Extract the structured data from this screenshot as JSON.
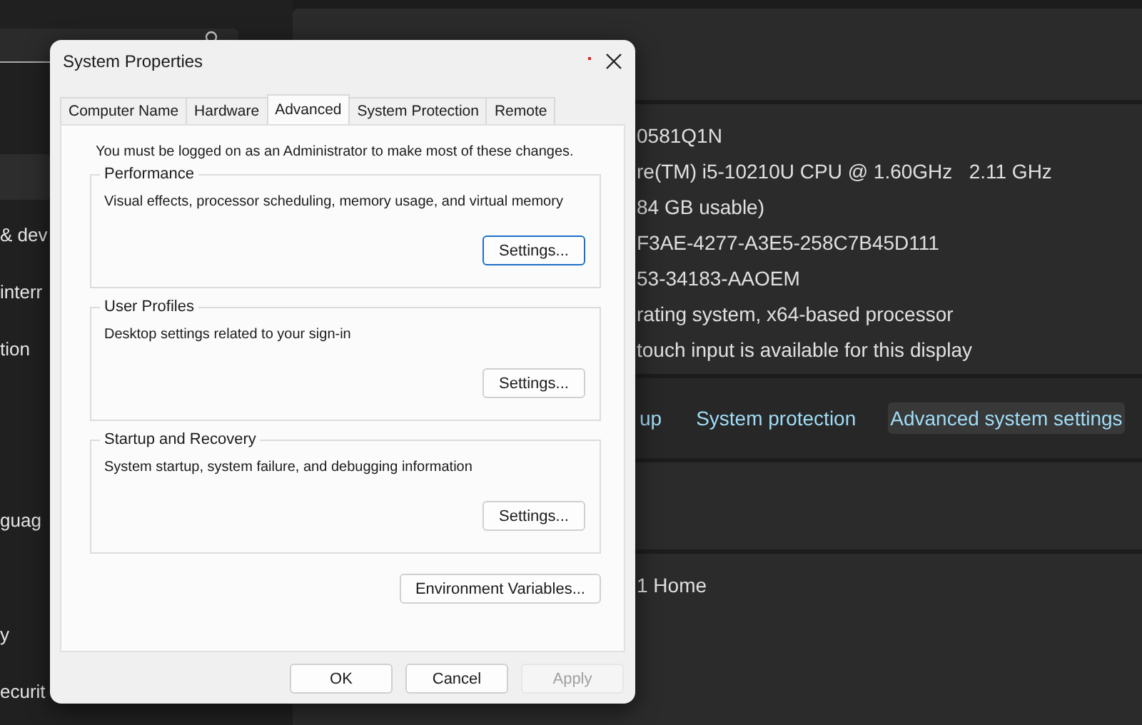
{
  "sidebar": {
    "items": [
      {
        "label": "& dev"
      },
      {
        "label": "interr"
      },
      {
        "label": "tion"
      },
      {
        "label": "guag"
      },
      {
        "label": "y"
      },
      {
        "label": "ecurit"
      }
    ]
  },
  "specs": {
    "lines": [
      "0581Q1N",
      "re(TM) i5-10210U CPU @ 1.60GHz   2.11 GHz",
      "84 GB usable)",
      "F3AE-4277-A3E5-258C7B45D111",
      "53-34183-AAOEM",
      "rating system, x64-based processor",
      "touch input is available for this display"
    ]
  },
  "related_links": [
    {
      "label": "up",
      "selected": false
    },
    {
      "label": "System protection",
      "selected": false
    },
    {
      "label": "Advanced system settings",
      "selected": true
    }
  ],
  "windows_spec": {
    "lines": [
      "1 Home"
    ]
  },
  "dialog": {
    "title": "System Properties",
    "tabs": [
      {
        "label": "Computer Name",
        "selected": false
      },
      {
        "label": "Hardware",
        "selected": false
      },
      {
        "label": "Advanced",
        "selected": true
      },
      {
        "label": "System Protection",
        "selected": false
      },
      {
        "label": "Remote",
        "selected": false
      }
    ],
    "notice": "You must be logged on as an Administrator to make most of these changes.",
    "groups": [
      {
        "title": "Performance",
        "description": "Visual effects, processor scheduling, memory usage, and virtual memory",
        "button": {
          "label": "Settings...",
          "focused": true
        }
      },
      {
        "title": "User Profiles",
        "description": "Desktop settings related to your sign-in",
        "button": {
          "label": "Settings...",
          "focused": false
        }
      },
      {
        "title": "Startup and Recovery",
        "description": "System startup, system failure, and debugging information",
        "button": {
          "label": "Settings...",
          "focused": false
        }
      }
    ],
    "env_button": {
      "label": "Environment Variables...",
      "focused": false
    },
    "buttons": [
      {
        "label": "OK",
        "disabled": false
      },
      {
        "label": "Cancel",
        "disabled": false
      },
      {
        "label": "Apply",
        "disabled": true
      }
    ]
  }
}
